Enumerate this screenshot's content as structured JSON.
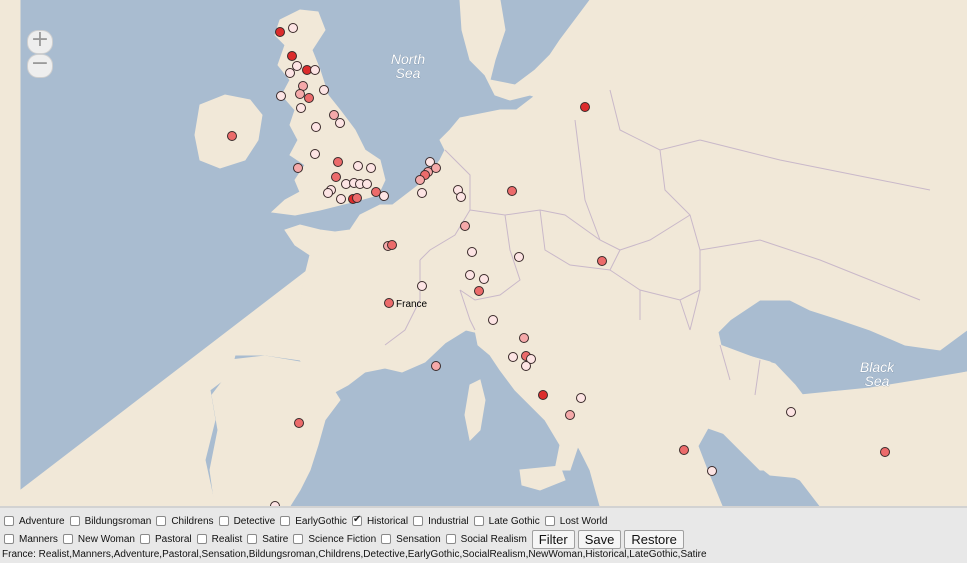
{
  "map": {
    "zoom_in_label": "+",
    "zoom_out_label": "−",
    "sea_labels": [
      {
        "id": "north-sea",
        "lines": [
          "North",
          "Sea"
        ]
      },
      {
        "id": "black-sea",
        "lines": [
          "Black",
          "Sea"
        ]
      }
    ],
    "place_labels": [
      {
        "id": "france",
        "text": "France"
      }
    ],
    "colors": {
      "water": "#a9bcd0",
      "land": "#f1e8d8",
      "borders": "#c9b8c9"
    },
    "marker_colors": [
      "#fde4e4",
      "#f5a9a9",
      "#ec6b6b",
      "#dc2c2c"
    ]
  },
  "filters": {
    "row1": [
      {
        "label": "Adventure",
        "checked": false
      },
      {
        "label": "Bildungsroman",
        "checked": false
      },
      {
        "label": "Childrens",
        "checked": false
      },
      {
        "label": "Detective",
        "checked": false
      },
      {
        "label": "EarlyGothic",
        "checked": false
      },
      {
        "label": "Historical",
        "checked": true
      },
      {
        "label": "Industrial",
        "checked": false
      },
      {
        "label": "Late Gothic",
        "checked": false
      },
      {
        "label": "Lost World",
        "checked": false
      }
    ],
    "row2": [
      {
        "label": "Manners",
        "checked": false
      },
      {
        "label": "New Woman",
        "checked": false
      },
      {
        "label": "Pastoral",
        "checked": false
      },
      {
        "label": "Realist",
        "checked": false
      },
      {
        "label": "Satire",
        "checked": false
      },
      {
        "label": "Science Fiction",
        "checked": false
      },
      {
        "label": "Sensation",
        "checked": false
      },
      {
        "label": "Social Realism",
        "checked": false
      }
    ]
  },
  "buttons": {
    "filter": "Filter",
    "save": "Save",
    "restore": "Restore"
  },
  "status": "France: Realist,Manners,Adventure,Pastoral,Sensation,Bildungsroman,Childrens,Detective,EarlyGothic,SocialRealism,NewWoman,Historical,LateGothic,Satire"
}
